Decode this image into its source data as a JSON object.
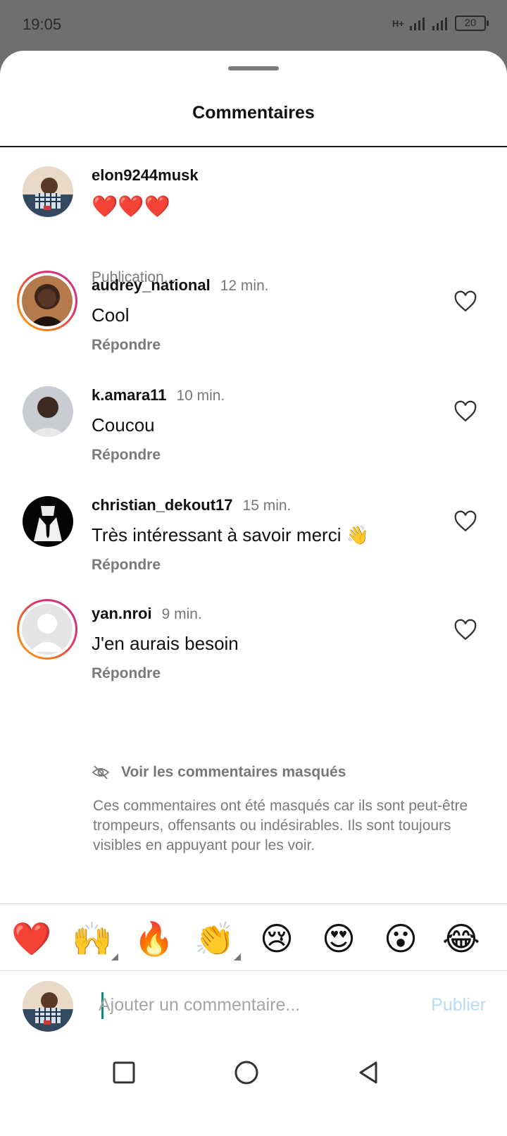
{
  "status": {
    "time": "19:05",
    "signal": "H+",
    "battery": "20"
  },
  "sheet": {
    "title": "Commentaires"
  },
  "post": {
    "username": "elon9244musk",
    "text": "❤️❤️❤️",
    "status": "Publication..."
  },
  "comments": [
    {
      "username": "audrey_national",
      "time": "12 min.",
      "text": "Cool",
      "reply": "Répondre"
    },
    {
      "username": "k.amara11",
      "time": "10 min.",
      "text": "Coucou",
      "reply": "Répondre"
    },
    {
      "username": "christian_dekout17",
      "time": "15 min.",
      "text": "Très intéressant à savoir merci 👋",
      "reply": "Répondre"
    },
    {
      "username": "yan.nroi",
      "time": "9 min.",
      "text": "J'en aurais besoin",
      "reply": "Répondre"
    }
  ],
  "hidden": {
    "label": "Voir les commentaires masqués",
    "note": "Ces commentaires ont été masqués car ils sont peut-être trompeurs, offensants ou indésirables. Ils sont toujours visibles en appuyant pour les voir."
  },
  "emojis": [
    "❤️",
    "🙌",
    "🔥",
    "👏",
    "😢",
    "😍",
    "😮",
    "😂"
  ],
  "composer": {
    "placeholder": "Ajouter un commentaire...",
    "publish": "Publier"
  },
  "colors": {
    "publish_disabled": "#b7dcf6",
    "ring_start": "#f9a825",
    "ring_end": "#c13584",
    "cursor": "#0a8c7a"
  },
  "icons": {
    "hidden": "eye-off-icon",
    "like": "heart-outline-icon",
    "recents": "square-icon",
    "home": "circle-icon",
    "back": "triangle-back-icon"
  }
}
